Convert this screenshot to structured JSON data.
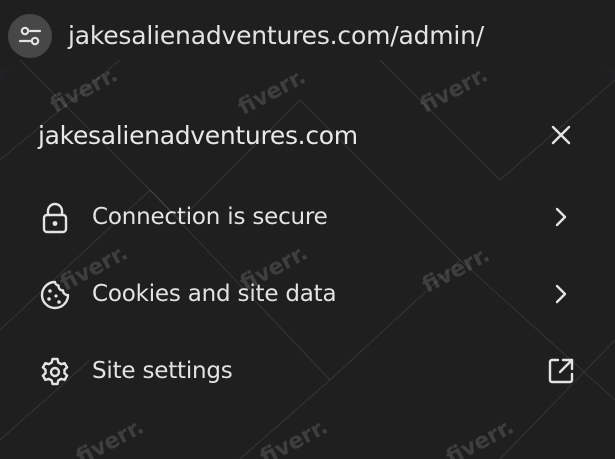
{
  "address_bar": {
    "url": "jakesalienadventures.com/admin/",
    "site_info_icon": "tune-icon"
  },
  "popup": {
    "title": "jakesalienadventures.com",
    "close_icon": "close-icon",
    "items": [
      {
        "label": "Connection is secure",
        "icon": "lock-icon",
        "trailing_icon": "chevron-right-icon"
      },
      {
        "label": "Cookies and site data",
        "icon": "cookie-icon",
        "trailing_icon": "chevron-right-icon"
      },
      {
        "label": "Site settings",
        "icon": "gear-icon",
        "trailing_icon": "open-in-new-icon"
      }
    ]
  },
  "watermark": {
    "text": "fiverr."
  },
  "colors": {
    "background": "#1f1f1f",
    "text": "#e3e3e3",
    "site_info_button": "#474747"
  }
}
